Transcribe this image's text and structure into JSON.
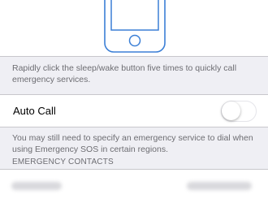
{
  "sos": {
    "illustration": "iphone-icon",
    "description": "Rapidly click the sleep/wake button five times to quickly call emergency services.",
    "auto_call": {
      "label": "Auto Call",
      "enabled": false
    },
    "auto_call_note": "You may still need to specify an emergency service to dial when using Emergency SOS in certain regions.",
    "contacts_header": "EMERGENCY CONTACTS"
  },
  "colors": {
    "background": "#efeff4",
    "illustration_blue": "#3b7fd6",
    "secondary_text": "#6d6d72",
    "separator": "#c8c7cc"
  }
}
